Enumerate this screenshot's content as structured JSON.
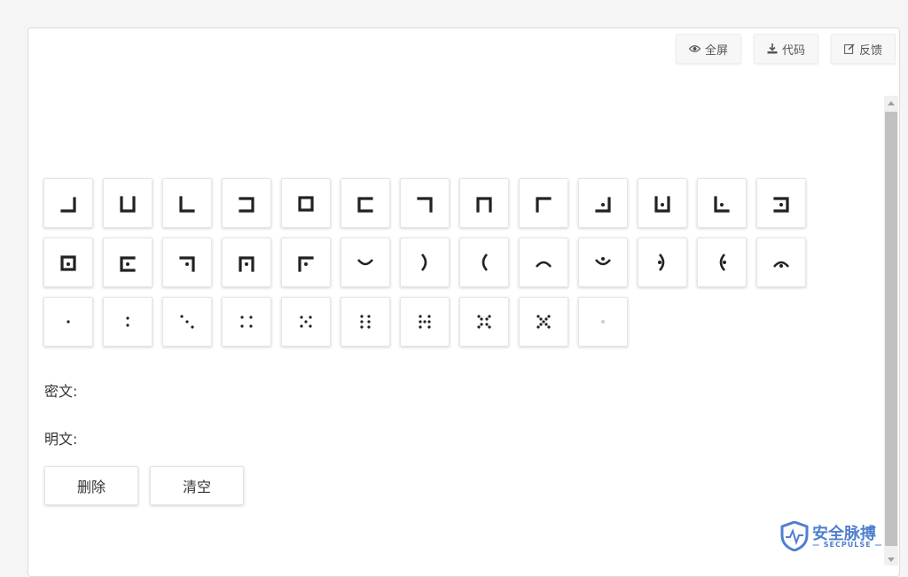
{
  "toolbar": {
    "fullscreen_label": "全屏",
    "code_label": "代码",
    "feedback_label": "反馈",
    "icons": [
      "eye-icon",
      "download-icon",
      "edit-icon"
    ]
  },
  "keypad": {
    "rows": [
      [
        "pigpen-1",
        "pigpen-2",
        "pigpen-3",
        "pigpen-4",
        "pigpen-5",
        "pigpen-6",
        "pigpen-7",
        "pigpen-8",
        "pigpen-9",
        "pigpen-dot-1",
        "pigpen-dot-2",
        "pigpen-dot-3",
        "pigpen-dot-4"
      ],
      [
        "pigpen-dot-5",
        "pigpen-dot-6",
        "pigpen-dot-7",
        "pigpen-dot-8",
        "pigpen-dot-9",
        "v-bottom",
        "v-right",
        "v-left",
        "v-top",
        "v-dot-bottom",
        "v-dot-right",
        "v-dot-left",
        "v-dot-top"
      ],
      [
        "dots-1",
        "dots-2",
        "dots-3",
        "dots-4",
        "dots-5",
        "dots-6",
        "dots-7",
        "dots-8",
        "dots-9",
        "dot-light"
      ]
    ]
  },
  "form": {
    "ciphertext_label": "密文:",
    "plaintext_label": "明文:",
    "delete_label": "删除",
    "clear_label": "清空"
  },
  "watermark": {
    "title": "安全脉搏",
    "subtitle": "— SECPULSE —",
    "brand_color": "#4f7fcf"
  }
}
